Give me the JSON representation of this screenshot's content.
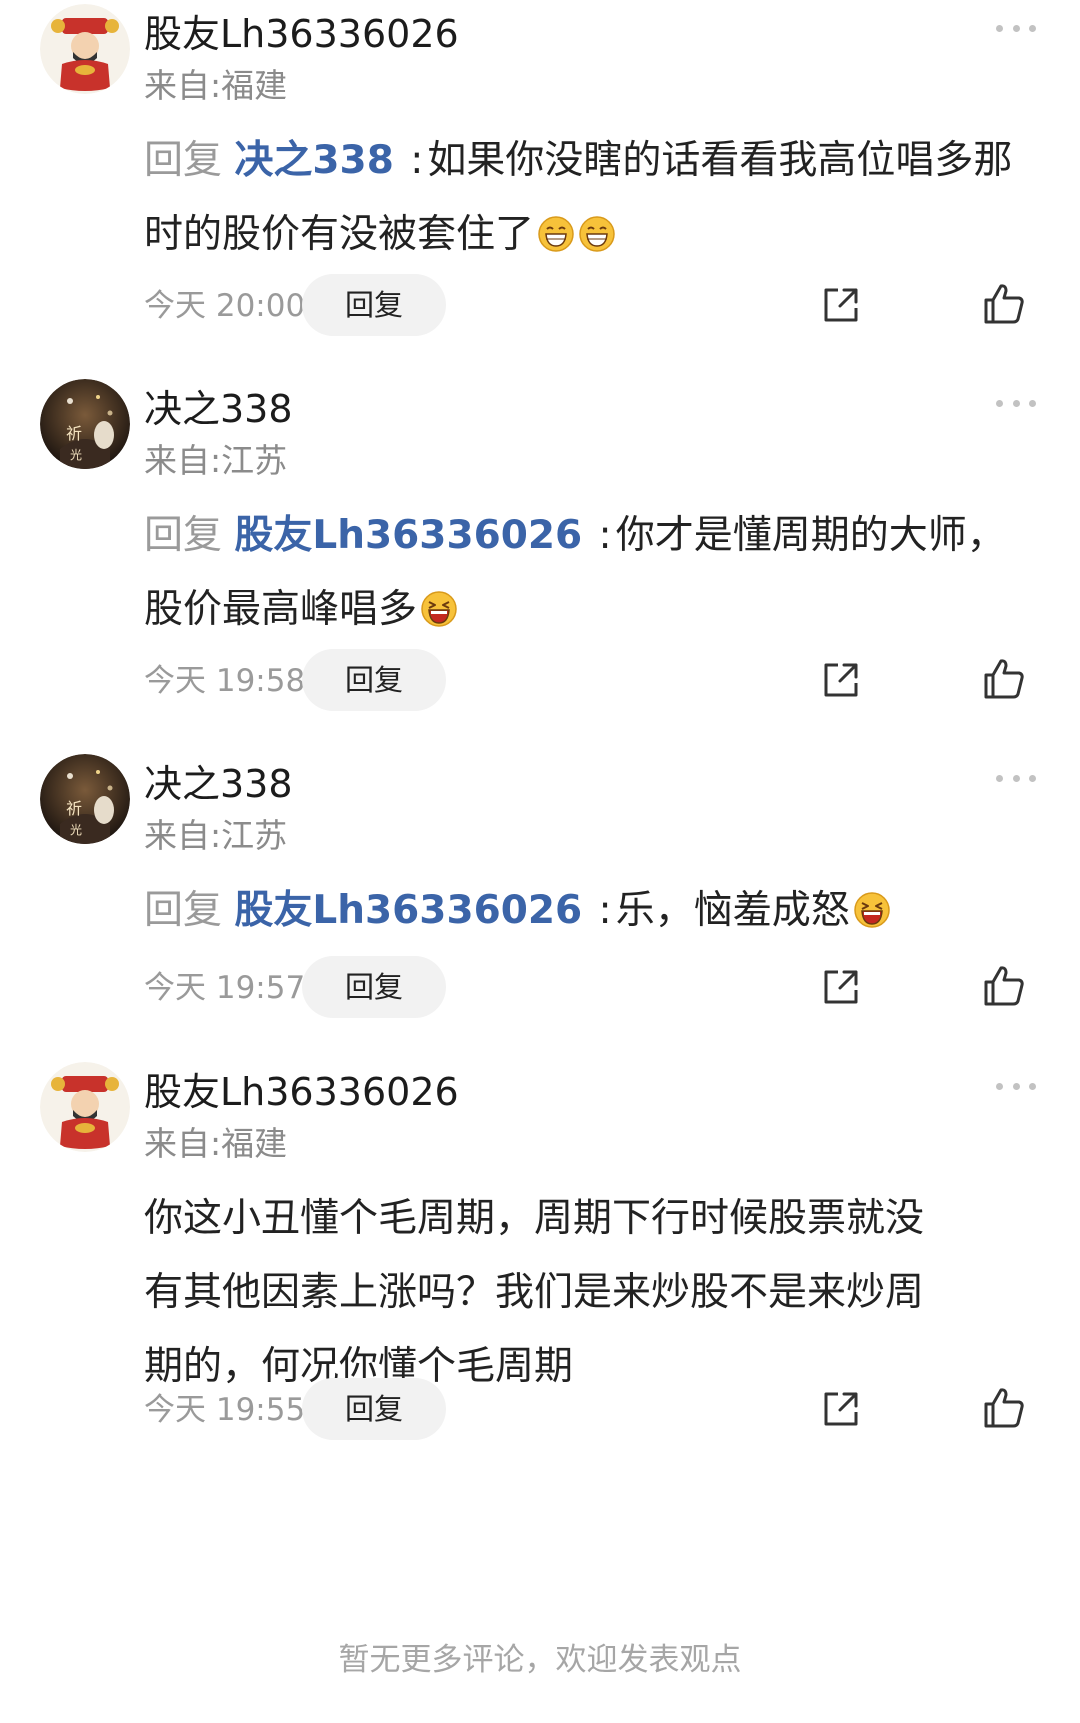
{
  "comments": [
    {
      "username": "股友Lh36336026",
      "location": "来自:福建",
      "reply_prefix": "回复",
      "reply_target": "决之338",
      "reply_colon": ":",
      "text": "如果你没瞎的话看看我高位唱多那时的股价有没被套住了",
      "emojis": [
        "grin-emoji",
        "grin-emoji"
      ],
      "time": "今天 20:00",
      "reply_button": "回复",
      "avatar": "caishen-avatar"
    },
    {
      "username": "决之338",
      "location": "来自:江苏",
      "reply_prefix": "回复",
      "reply_target": "股友Lh36336026",
      "reply_colon": ":",
      "text": "你才是懂周期的大师，股价最高峰唱多",
      "emojis": [
        "laugh-emoji"
      ],
      "time": "今天 19:58",
      "reply_button": "回复",
      "avatar": "night-scene-avatar"
    },
    {
      "username": "决之338",
      "location": "来自:江苏",
      "reply_prefix": "回复",
      "reply_target": "股友Lh36336026",
      "reply_colon": ":",
      "text": "乐，恼羞成怒",
      "emojis": [
        "laugh-emoji"
      ],
      "time": "今天 19:57",
      "reply_button": "回复",
      "avatar": "night-scene-avatar"
    },
    {
      "username": "股友Lh36336026",
      "location": "来自:福建",
      "text": "你这小丑懂个毛周期，周期下行时候股票就没有其他因素上涨吗？我们是来炒股不是来炒周期的，何况你懂个毛周期",
      "time": "今天 19:55",
      "reply_button": "回复",
      "avatar": "caishen-avatar"
    }
  ],
  "footer": "暂无更多评论，欢迎发表观点",
  "colors": {
    "reply_target": "#3b64a8",
    "muted": "#9a9a9a",
    "button_bg": "#f2f2f2"
  }
}
